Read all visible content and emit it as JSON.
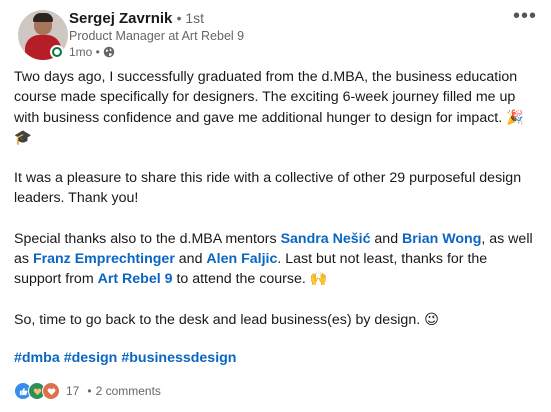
{
  "author": {
    "name": "Sergej Zavrnik",
    "degree": "• 1st",
    "headline": "Product Manager at Art Rebel 9",
    "time": "1mo •",
    "visibility_icon": "globe-icon"
  },
  "post": {
    "p1": "Two days ago, I successfully graduated from the d.MBA, the business education course made specifically for designers. The exciting 6-week journey filled me up with business confidence and gave me additional hunger to design for impact.",
    "p1_emoji": "🎉🎓",
    "p2": "It was a pleasure to share this ride with a collective of other 29 purposeful design leaders. Thank you!",
    "p3_a": "Special thanks also to the d.MBA mentors ",
    "mention1": "Sandra Nešić",
    "p3_b": " and ",
    "mention2": "Brian Wong",
    "p3_c": ", as well as ",
    "mention3": "Franz Emprechtinger",
    "p3_d": " and ",
    "mention4": "Alen Faljic",
    "p3_e": ". Last but not least, thanks for the support from ",
    "mention5": "Art Rebel 9",
    "p3_f": " to attend the course. ",
    "p3_emoji": "🙌",
    "p4": "So, time to go back to the desk and lead business(es) by design. ",
    "p4_emoji": "😉",
    "hashtags": [
      "#dmba",
      "#design",
      "#businessdesign"
    ]
  },
  "social": {
    "reactions": [
      "like-icon",
      "support-icon",
      "love-icon"
    ],
    "count": "17",
    "separator": "•",
    "comments": "2 comments"
  },
  "colors": {
    "link": "#0a66c2",
    "online": "#057642",
    "like": "#378fe9",
    "support": "#2f8f5b",
    "love": "#df704d"
  }
}
